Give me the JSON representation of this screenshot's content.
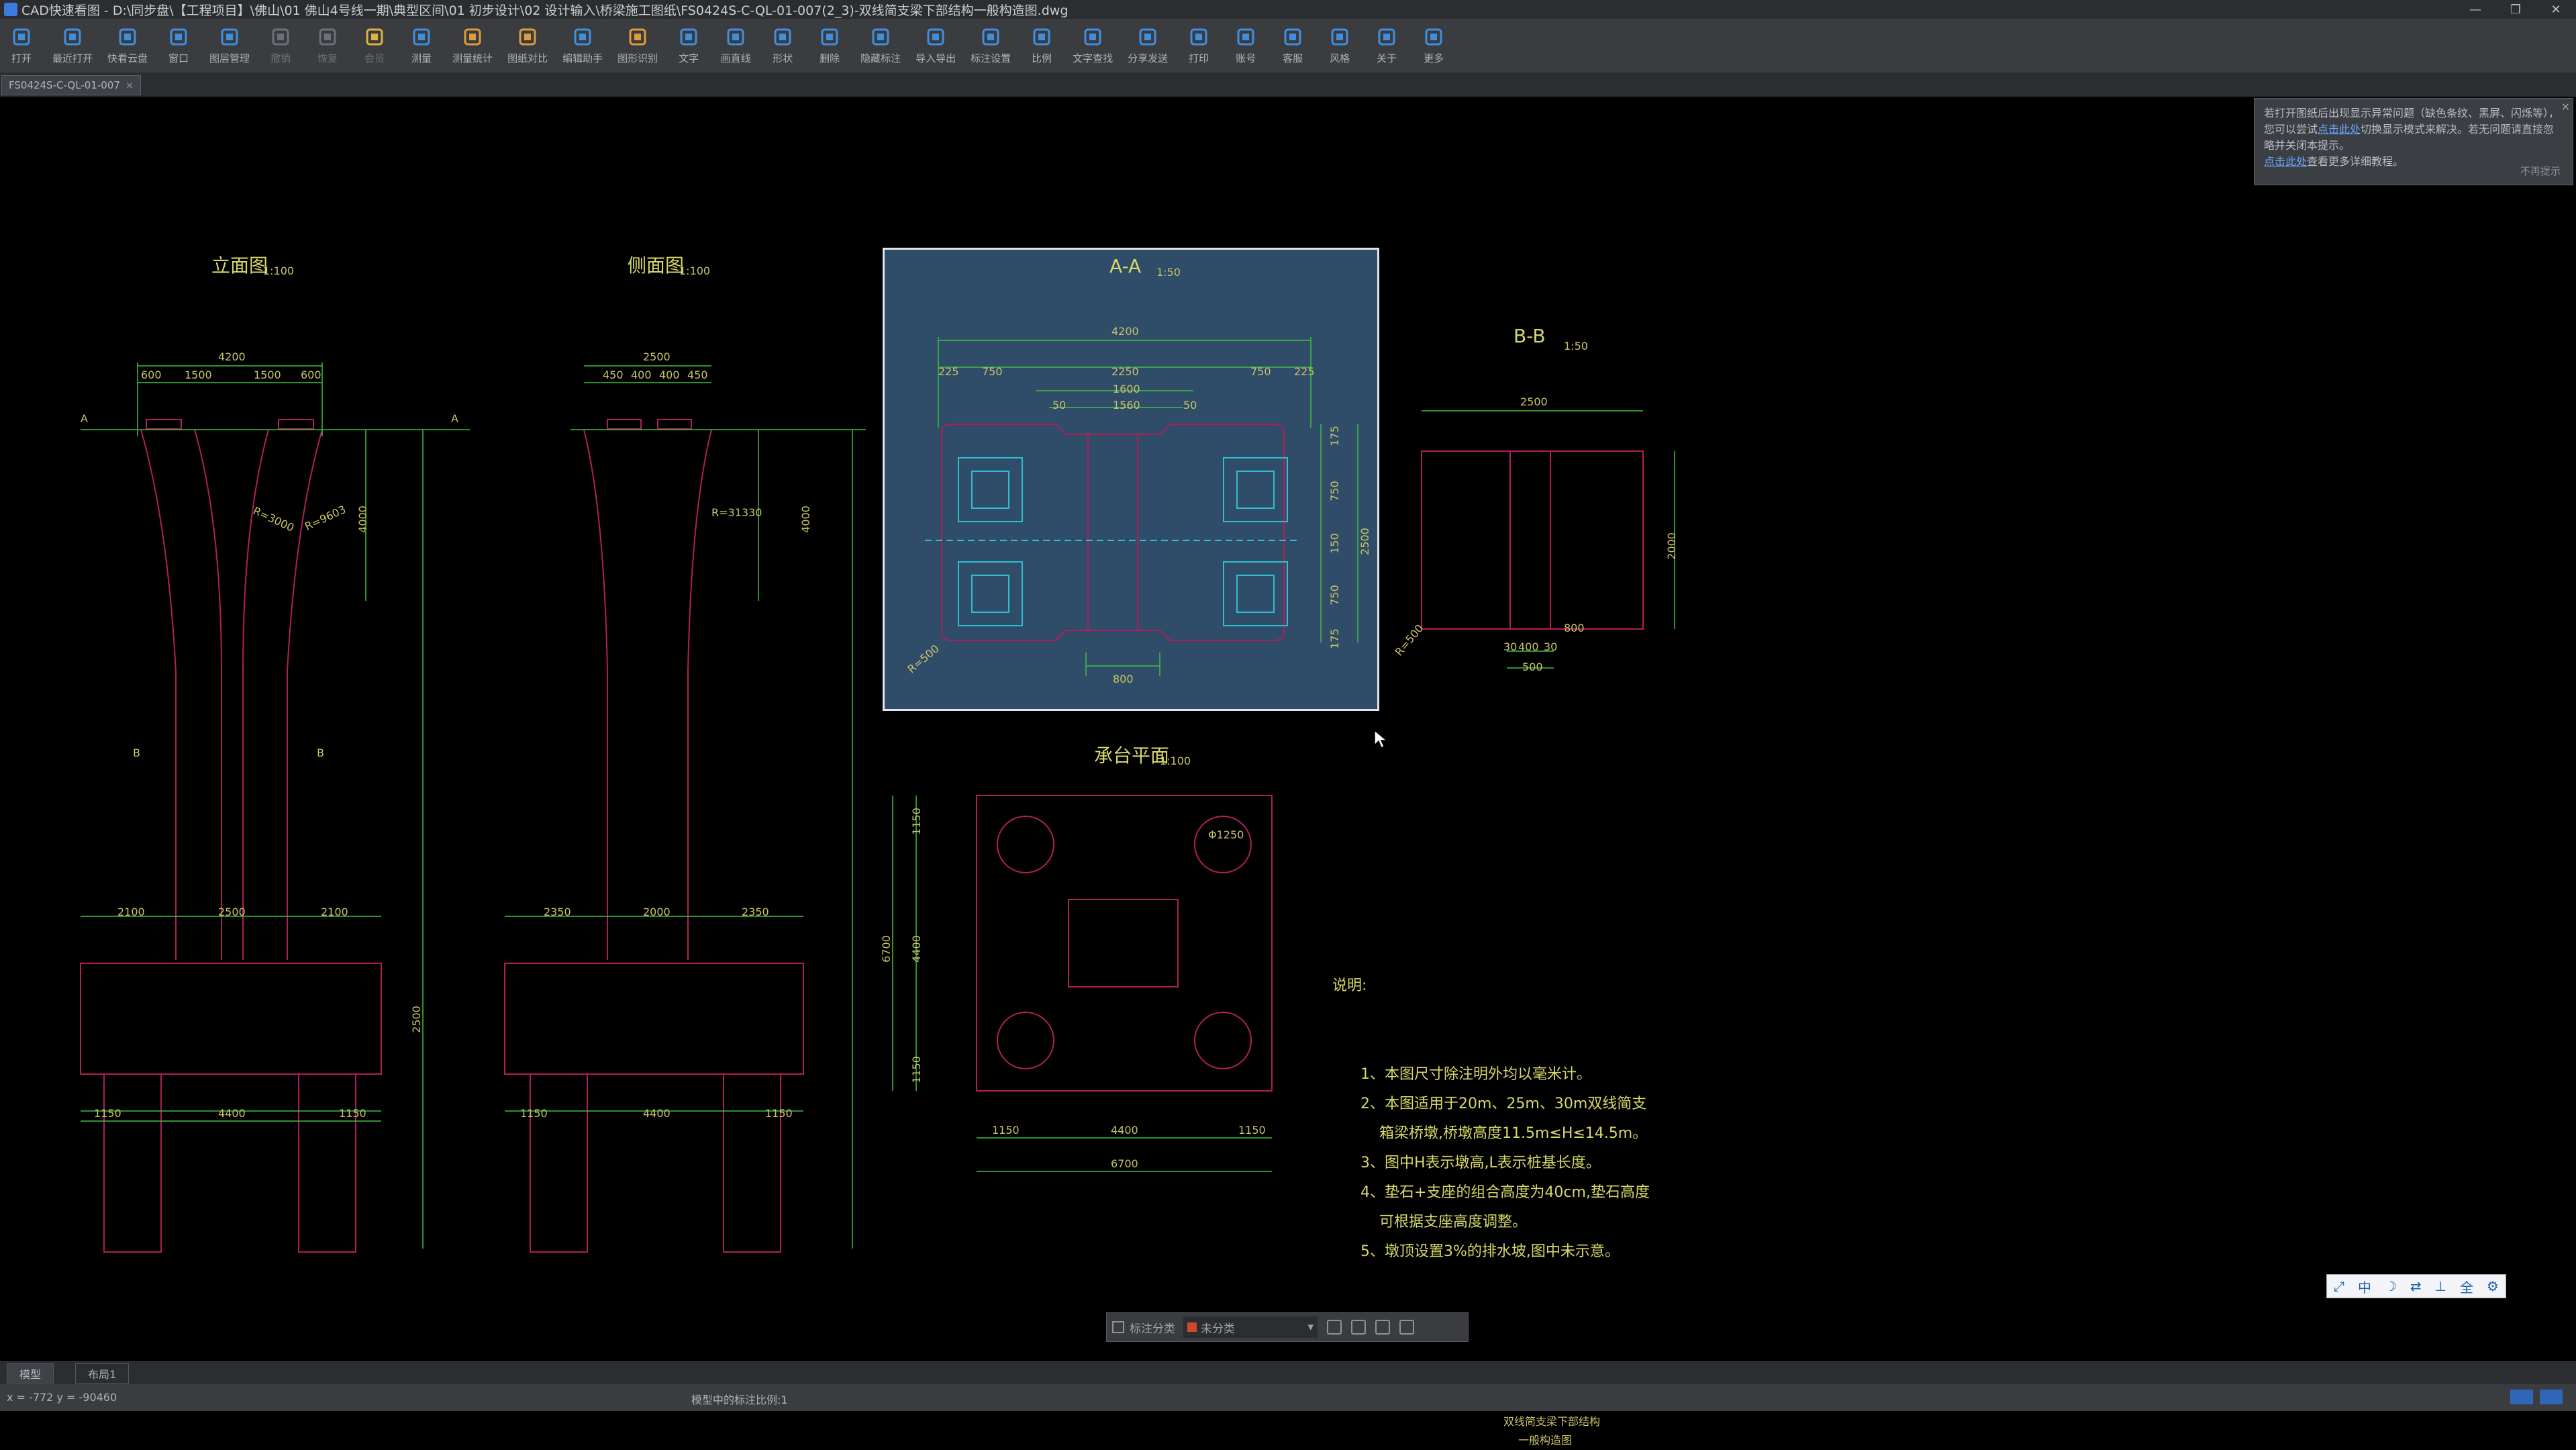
{
  "window": {
    "title": "CAD快速看图 - D:\\同步盘\\【工程项目】\\佛山\\01 佛山4号线一期\\典型区间\\01 初步设计\\02 设计输入\\桥梁施工图纸\\FS0424S-C-QL-01-007(2_3)-双线简支梁下部结构一般构造图.dwg",
    "controls": [
      "—",
      "❐",
      "✕"
    ]
  },
  "toolbar": {
    "items": [
      {
        "label": "打开",
        "icon": "open-folder-icon",
        "color": "#3f8fe0"
      },
      {
        "label": "最近打开",
        "icon": "history-icon",
        "color": "#3f8fe0"
      },
      {
        "label": "快看云盘",
        "icon": "cloud-icon",
        "color": "#3f8fe0"
      },
      {
        "label": "窗口",
        "icon": "window-icon",
        "color": "#3f8fe0"
      },
      {
        "label": "图层管理",
        "icon": "layers-icon",
        "color": "#3f8fe0"
      },
      {
        "label": "撤销",
        "icon": "undo-icon",
        "color": "#6c7178",
        "dim": true
      },
      {
        "label": "恢复",
        "icon": "redo-icon",
        "color": "#6c7178",
        "dim": true
      },
      {
        "label": "会员",
        "icon": "vip-icon",
        "color": "#e0b23f",
        "dim": true
      },
      {
        "label": "测量",
        "icon": "measure-icon",
        "color": "#3f8fe0"
      },
      {
        "label": "测量统计",
        "icon": "measure-stats-icon",
        "color": "#e09a3f"
      },
      {
        "label": "图纸对比",
        "icon": "compare-icon",
        "color": "#e09a3f"
      },
      {
        "label": "编辑助手",
        "icon": "edit-helper-icon",
        "color": "#3f8fe0"
      },
      {
        "label": "图形识别",
        "icon": "recognize-icon",
        "color": "#e09a3f"
      },
      {
        "label": "文字",
        "icon": "text-icon",
        "color": "#3f8fe0"
      },
      {
        "label": "画直线",
        "icon": "line-icon",
        "color": "#3f8fe0"
      },
      {
        "label": "形状",
        "icon": "shape-icon",
        "color": "#3f8fe0"
      },
      {
        "label": "删除",
        "icon": "delete-icon",
        "color": "#3f8fe0"
      },
      {
        "label": "隐藏标注",
        "icon": "hide-mark-icon",
        "color": "#3f8fe0"
      },
      {
        "label": "导入导出",
        "icon": "import-export-icon",
        "color": "#3f8fe0"
      },
      {
        "label": "标注设置",
        "icon": "mark-settings-icon",
        "color": "#3f8fe0"
      },
      {
        "label": "比例",
        "icon": "scale-icon",
        "color": "#3f8fe0"
      },
      {
        "label": "文字查找",
        "icon": "text-search-icon",
        "color": "#3f8fe0"
      },
      {
        "label": "分享发送",
        "icon": "share-icon",
        "color": "#3f8fe0"
      },
      {
        "label": "打印",
        "icon": "print-icon",
        "color": "#3f8fe0"
      },
      {
        "label": "账号",
        "icon": "account-icon",
        "color": "#3f8fe0"
      },
      {
        "label": "客服",
        "icon": "support-icon",
        "color": "#3f8fe0"
      },
      {
        "label": "风格",
        "icon": "style-icon",
        "color": "#3f8fe0"
      },
      {
        "label": "关于",
        "icon": "about-icon",
        "color": "#3f8fe0"
      },
      {
        "label": "更多",
        "icon": "more-icon",
        "color": "#3f8fe0"
      }
    ]
  },
  "doc_tab": {
    "name": "FS0424S-C-QL-01-007",
    "close": "×"
  },
  "notice": {
    "text1": "若打开图纸后出现显示异常问题（缺色条纹、黑屏、闪烁等），您可以尝试",
    "link1": "点击此处",
    "text2": "切换显示模式来解决。若无问题请直接忽略并关闭本提示。",
    "link2": "点击此处",
    "text3": "查看更多详细教程。",
    "dismiss": "不再提示",
    "close": "×"
  },
  "drawing": {
    "front_view": {
      "title": "立面图",
      "scale": "1:100"
    },
    "side_view": {
      "title": "侧面图",
      "scale": "1:100"
    },
    "section_aa": {
      "title": "A-A",
      "scale": "1:50"
    },
    "section_bb": {
      "title": "B-B",
      "scale": "1:50"
    },
    "cap_plan": {
      "title": "承台平面",
      "scale": "1:100"
    },
    "dims": {
      "fv_top": "4200",
      "fv_a": "600",
      "fv_b": "1500",
      "fv_c": "1500",
      "fv_d": "600",
      "fv_r1": "R=3000",
      "fv_r2": "R=9603",
      "fv_h": "4000",
      "fv_bot_a": "2100",
      "fv_bot_b": "2500",
      "fv_bot_c": "2100",
      "fv_cap": "4400",
      "fv_side_l": "1150",
      "fv_side_r": "1150",
      "fv_capH": "2500",
      "sv_top": "2500",
      "sv_a": "450",
      "sv_b": "400",
      "sv_c": "400",
      "sv_d": "450",
      "sv_r": "R=31330",
      "sv_h": "4000",
      "sv_bot_a": "2350",
      "sv_bot_b": "2000",
      "sv_bot_c": "2350",
      "sv_cap": "4400",
      "sv_side_l": "1150",
      "sv_side_r": "1150",
      "aa_top": "4200",
      "aa_a": "225",
      "aa_b": "750",
      "aa_c": "2250",
      "aa_d": "750",
      "aa_e": "225",
      "aa_f": "1600",
      "aa_g": "1560",
      "aa_h": "50",
      "aa_i": "50",
      "aa_v1": "175",
      "aa_v2": "750",
      "aa_v3": "150",
      "aa_v4": "750",
      "aa_v5": "175",
      "aa_vt": "2500",
      "aa_r": "R=500",
      "aa_bot": "800",
      "bb_top": "2500",
      "bb_v": "2000",
      "bb_r": "R=500",
      "bb_a": "400",
      "bb_b": "500",
      "bb_c": "30",
      "bb_d": "30",
      "bb_e": "800",
      "cp_a": "1150",
      "cp_b": "4400",
      "cp_c": "1150",
      "cp_w": "6700",
      "cp_h": "6700",
      "cp_v1": "1150",
      "cp_v2": "4400",
      "cp_v3": "1150",
      "cp_pile": "Φ1250"
    },
    "section_marks": {
      "a": "A",
      "b": "B"
    },
    "notes_title": "说明:",
    "notes": [
      "1、本图尺寸除注明外均以毫米计。",
      "2、本图适用于20m、25m、30m双线简支",
      "    箱梁桥墩,桥墩高度11.5m≤H≤14.5m。",
      "3、图中H表示墩高,L表示桩基长度。",
      "4、垫石+支座的组合高度为40cm,垫石高度",
      "    可根据支座高度调整。",
      "5、墩顶设置3%的排水坡,图中未示意。"
    ],
    "title_block": [
      "双线简支梁下部结构",
      "一般构造图"
    ]
  },
  "floatbar": {
    "category_label": "标注分类",
    "selected": "未分类",
    "arrow": "▾"
  },
  "viewbar": {
    "items": [
      "⤢",
      "中",
      "☽",
      "⇄",
      "⊥",
      "全",
      "⚙"
    ]
  },
  "layout_tabs": [
    "模型",
    "布局1"
  ],
  "status": {
    "coord": "x = -772  y = -90460",
    "scale_text": "模型中的标注比例:1"
  },
  "colors": {
    "pier": "#b21e5c",
    "dim": "#3fbf3f",
    "section_bg": "#2f4c68",
    "cyan": "#2fbfd0",
    "text_yellow": "#d8d86a"
  }
}
